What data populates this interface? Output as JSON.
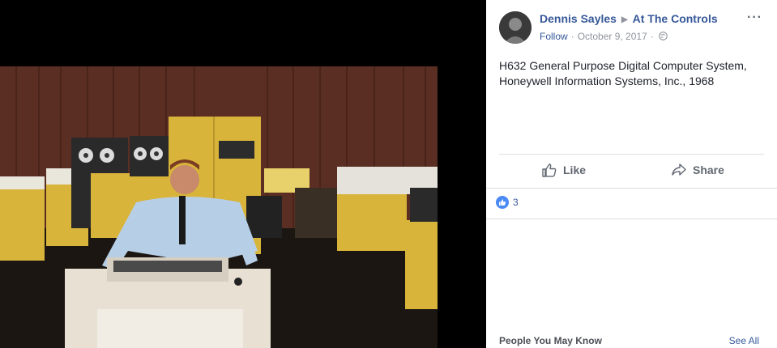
{
  "post": {
    "author": "Dennis Sayles",
    "page": "At The Controls",
    "follow_label": "Follow",
    "date": "October 9, 2017",
    "caption_line1": "H632 General Purpose Digital Computer System,",
    "caption_line2": "Honeywell Information Systems, Inc., 1968",
    "more_label": "···"
  },
  "actions": {
    "like_label": "Like",
    "share_label": "Share"
  },
  "reactions": {
    "count": "3"
  },
  "pymk": {
    "title": "People You May Know",
    "see_all": "See All"
  },
  "colors": {
    "link": "#365899",
    "muted": "#90949c",
    "reaction": "#4a8af4",
    "cabinet_yellow": "#d9b43a",
    "wood_panel": "#5a2e22"
  },
  "icons": {
    "avatar": "avatar-image",
    "globe": "globe-icon",
    "like": "thumbs-up-icon",
    "share": "share-arrow-icon",
    "more": "more-options-icon"
  }
}
